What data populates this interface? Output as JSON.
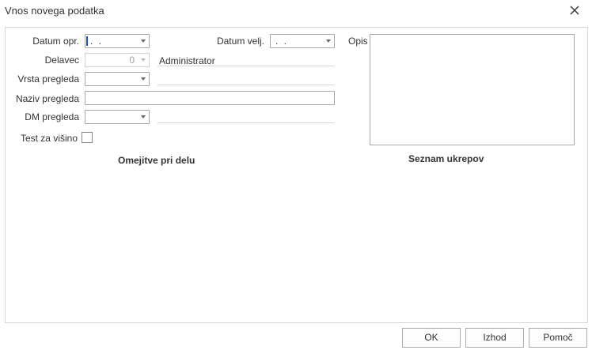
{
  "window": {
    "title": "Vnos novega podatka"
  },
  "form": {
    "datum_opr": {
      "label": "Datum opr.",
      "value": ". ."
    },
    "datum_velj": {
      "label": "Datum velj.",
      "value": ". ."
    },
    "delavec": {
      "label": "Delavec",
      "value": "0",
      "name": "Administrator"
    },
    "vrsta_pregleda": {
      "label": "Vrsta pregleda",
      "value": ""
    },
    "naziv_pregleda": {
      "label": "Naziv pregleda",
      "value": ""
    },
    "dm_pregleda": {
      "label": "DM pregleda",
      "value": ""
    },
    "test_za_visino": {
      "label": "Test za višino",
      "checked": false
    },
    "opis": {
      "label": "Opis",
      "value": ""
    }
  },
  "sections": {
    "omejitve": "Omejitve pri delu",
    "ukrepi": "Seznam ukrepov"
  },
  "buttons": {
    "ok": "OK",
    "izhod": "Izhod",
    "pomoc": "Pomoč"
  }
}
